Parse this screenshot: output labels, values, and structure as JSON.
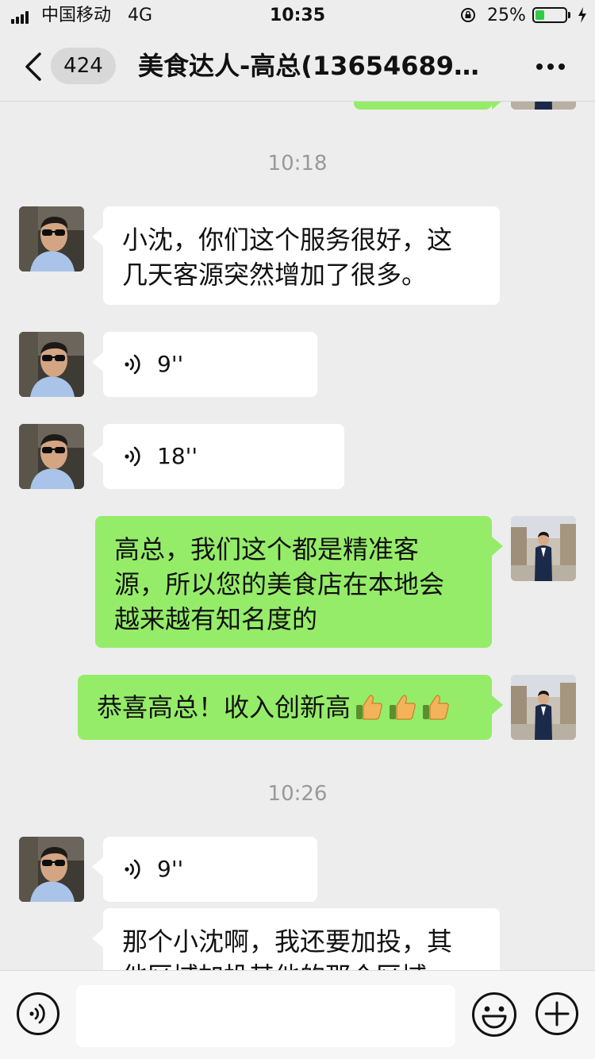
{
  "status_bar": {
    "carrier": "中国移动",
    "network": "4G",
    "time": "10:35",
    "battery_percent": "25%",
    "battery_level": 0.25,
    "icons": [
      "signal-bars-icon",
      "orientation-lock-icon",
      "battery-icon",
      "charging-bolt-icon"
    ]
  },
  "nav": {
    "back_icon": "chevron-left-icon",
    "unread_count": "424",
    "title": "美食达人-高总(13654689…",
    "more_icon": "more-dots-icon"
  },
  "messages": [
    {
      "type": "timestamp",
      "text": "10:18"
    },
    {
      "type": "text",
      "sender": "contact",
      "lines": [
        "小沈，你们这个服务很好，这",
        "几天客源突然增加了很多。"
      ]
    },
    {
      "type": "voice",
      "sender": "contact",
      "duration": "9''"
    },
    {
      "type": "voice",
      "sender": "contact",
      "duration": "18''"
    },
    {
      "type": "text",
      "sender": "me",
      "lines": [
        "高总，我们这个都是精准客",
        "源，所以您的美食店在本地会",
        "越来越有知名度的"
      ]
    },
    {
      "type": "text",
      "sender": "me",
      "text": "恭喜高总！收入创新高",
      "emoji": [
        "thumbs-up-icon",
        "thumbs-up-icon",
        "thumbs-up-icon"
      ]
    },
    {
      "type": "timestamp",
      "text": "10:26"
    },
    {
      "type": "voice",
      "sender": "contact",
      "duration": "9''"
    },
    {
      "type": "text",
      "sender": "contact",
      "lines": [
        "那个小沈啊，我还要加投，其",
        "他区域加投其他的那个区域"
      ]
    }
  ],
  "input_bar": {
    "voice_icon": "voice-input-icon",
    "text_value": "",
    "emoji_icon": "emoji-icon",
    "plus_icon": "plus-icon"
  },
  "colors": {
    "background": "#ededed",
    "incoming_bubble": "#ffffff",
    "outgoing_bubble": "#95ec69",
    "timestamp": "#999999",
    "battery_fill": "#2fcc4a"
  }
}
